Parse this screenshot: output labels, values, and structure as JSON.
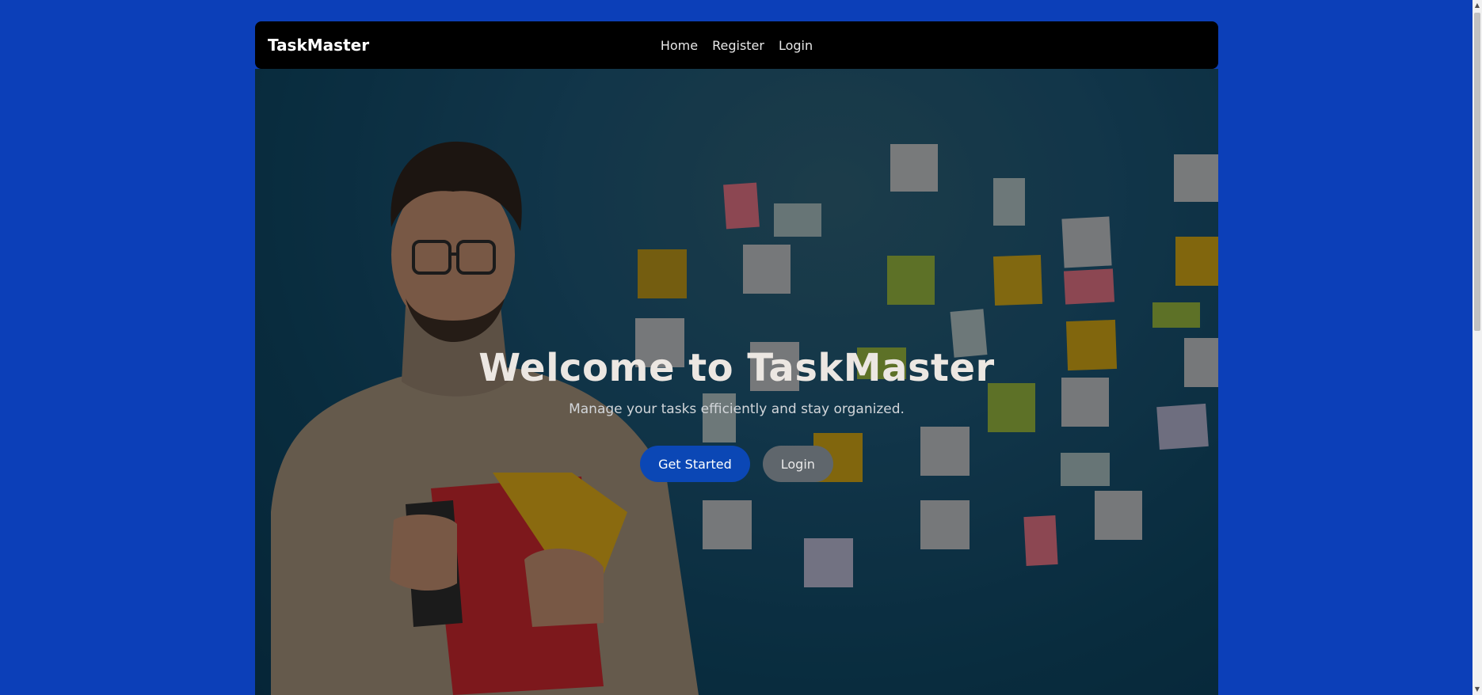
{
  "navbar": {
    "brand": "TaskMaster",
    "links": [
      "Home",
      "Register",
      "Login"
    ]
  },
  "hero": {
    "title": "Welcome to TaskMaster",
    "subtitle": "Manage your tasks efficiently and stay organized.",
    "primary_button": "Get Started",
    "secondary_button": "Login"
  },
  "scrollbar": {
    "up_arrow": "▲",
    "down_arrow": "▼"
  },
  "colors": {
    "page_background": "#0c3fb8",
    "navbar_background": "#000000",
    "primary_button": "#0b47b5",
    "secondary_button": "#5f666c"
  }
}
